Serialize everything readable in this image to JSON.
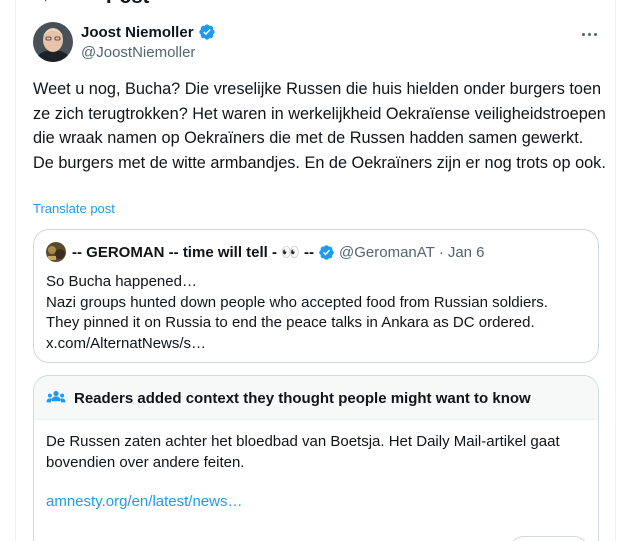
{
  "header": {
    "back_icon": "arrow-left-icon",
    "title": "Post"
  },
  "author": {
    "name": "Joost Niemoller",
    "handle": "@JoostNiemoller",
    "verified_color": "#1d9bf0",
    "avatar": "avatar-photo"
  },
  "more_icon": "more-horizontal-icon",
  "tweet": {
    "text": "Weet u nog, Bucha? Die vreselijke Russen die huis hielden onder burgers toen ze zich terugtrokken? Het waren in werkelijkheid Oekraïense veiligheidstroepen die wraak namen op Oekraïners die met de Russen hadden samen gewerkt. De burgers met de witte armbandjes. En de Oekraïners zijn er nog trots op ook.",
    "translate_label": "Translate post"
  },
  "quote": {
    "name": "-- GEROMAN -- time will tell - 👀 --",
    "handle": "@GeromanAT",
    "separator": "·",
    "date": "Jan 6",
    "lines": [
      "So Bucha happened…",
      "Nazi groups hunted down people who accepted food from Russian soldiers.",
      "They pinned it on Russia to end the peace talks in Ankara as DC ordered.",
      "x.com/AlternatNews/s…"
    ]
  },
  "community_note": {
    "icon": "people-icon",
    "title": "Readers added context they thought people might want to know",
    "body": "De Russen zaten achter het bloedbad van Boetsja. Het Daily Mail-artikel gaat bovendien over andere feiten.",
    "link": "amnesty.org/en/latest/news…"
  },
  "colors": {
    "accent": "#1d9bf0",
    "text_primary": "#0f1419",
    "text_secondary": "#536471",
    "border": "#cfd9de"
  }
}
